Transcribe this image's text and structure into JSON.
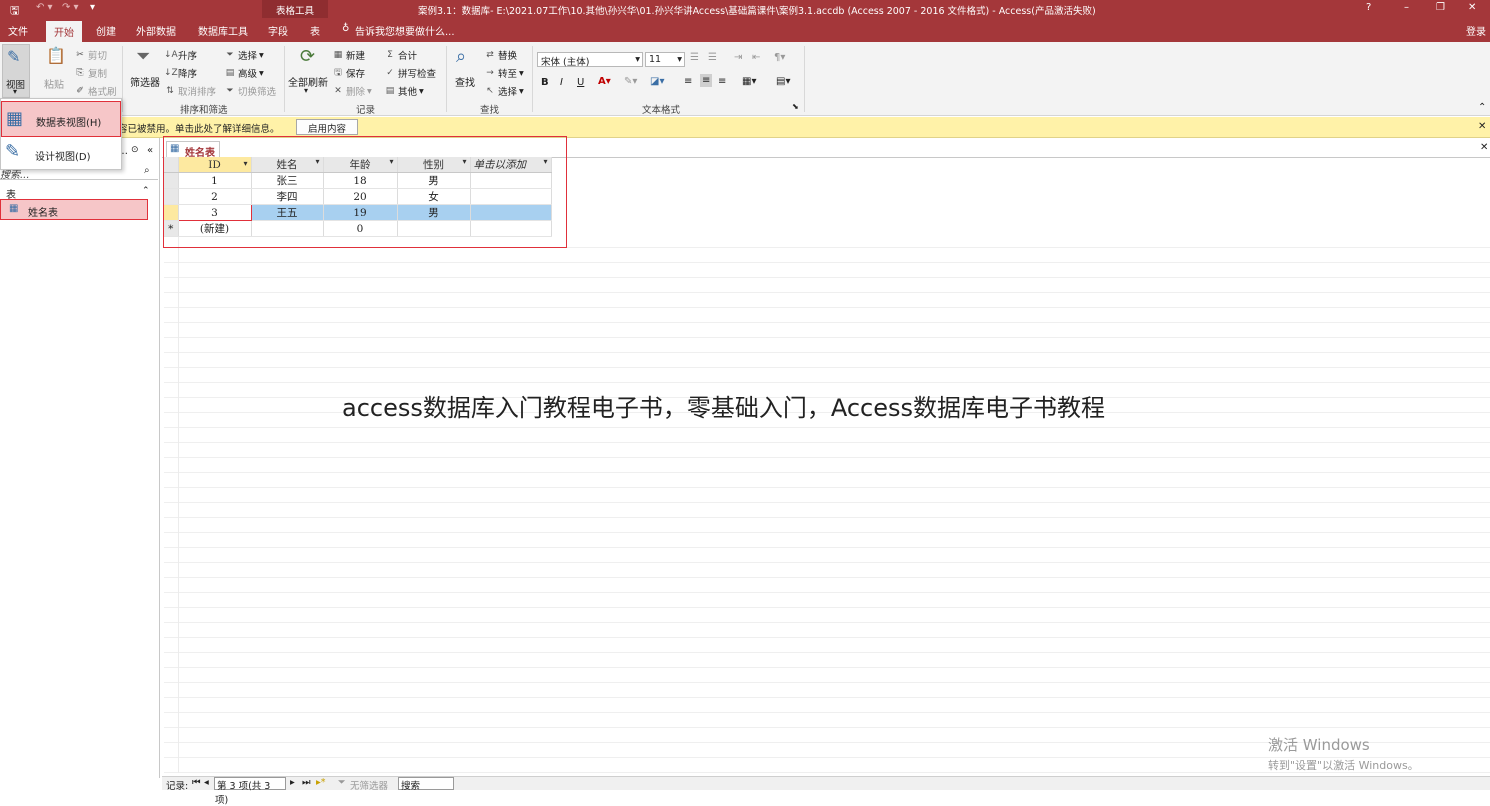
{
  "title_bar": {
    "title": "案例3.1：数据库- E:\\2021.07工作\\10.其他\\孙兴华\\01.孙兴华讲Access\\基础篇课件\\案例3.1.accdb (Access 2007 - 2016 文件格式) - Access(产品激活失败)",
    "context_tools": "表格工具",
    "help": "?",
    "minimize": "–",
    "restore": "❐",
    "close": "✕"
  },
  "ribbon_tabs": [
    "文件",
    "开始",
    "创建",
    "外部数据",
    "数据库工具",
    "字段",
    "表"
  ],
  "tell_me": "告诉我您想要做什么...",
  "sign_in": "登录",
  "ribbon": {
    "view": "视图",
    "paste": "粘贴",
    "cut": "剪切",
    "copy": "复制",
    "format_painter": "格式刷",
    "filter": "筛选器",
    "ascending": "升序",
    "descending": "降序",
    "remove_sort": "取消排序",
    "selection": "选择",
    "advanced": "高级",
    "toggle_filter": "切换筛选",
    "refresh_all": "全部刷新",
    "new": "新建",
    "save": "保存",
    "delete": "删除",
    "totals": "合计",
    "spelling": "拼写检查",
    "more": "其他",
    "find": "查找",
    "replace": "替换",
    "goto": "转至",
    "select": "选择",
    "font_name": "宋体 (主体)",
    "font_size": "11",
    "bold": "B",
    "italic": "I",
    "underline": "U",
    "groups": {
      "sort_filter": "排序和筛选",
      "records": "记录",
      "find": "查找",
      "text_format": "文本格式"
    }
  },
  "message_bar": {
    "text": "容已被禁用。单击此处了解详细信息。",
    "button": "启用内容",
    "close": "✕"
  },
  "view_menu": {
    "items": [
      {
        "label": "数据表视图(H)"
      },
      {
        "label": "设计视图(D)"
      }
    ]
  },
  "nav_pane": {
    "search_placeholder": "搜索...",
    "section": "表",
    "item": "姓名表"
  },
  "doc_tab": "姓名表",
  "doc_close": "✕",
  "table": {
    "columns": [
      "ID",
      "姓名",
      "年龄",
      "性别",
      "单击以添加"
    ],
    "rows": [
      {
        "id": "1",
        "name": "张三",
        "age": "18",
        "gender": "男"
      },
      {
        "id": "2",
        "name": "李四",
        "age": "20",
        "gender": "女"
      },
      {
        "id": "3",
        "name": "王五",
        "age": "19",
        "gender": "男"
      }
    ],
    "new_row": {
      "marker": "*",
      "id": "(新建)",
      "age": "0"
    }
  },
  "status_bar": {
    "record_label": "记录:",
    "record_position": "第 3 项(共 3 项)",
    "filter": "无筛选器",
    "search": "搜索"
  },
  "overlay_text": "access数据库入门教程电子书，零基础入门，Access数据库电子书教程",
  "windows_watermark": {
    "line1": "激活 Windows",
    "line2": "转到\"设置\"以激活 Windows。"
  },
  "colors": {
    "accent": "#a4373a",
    "highlight_row": "#a8d0f0",
    "message_bar": "#fff2a8",
    "red_outline": "#e0303a"
  }
}
